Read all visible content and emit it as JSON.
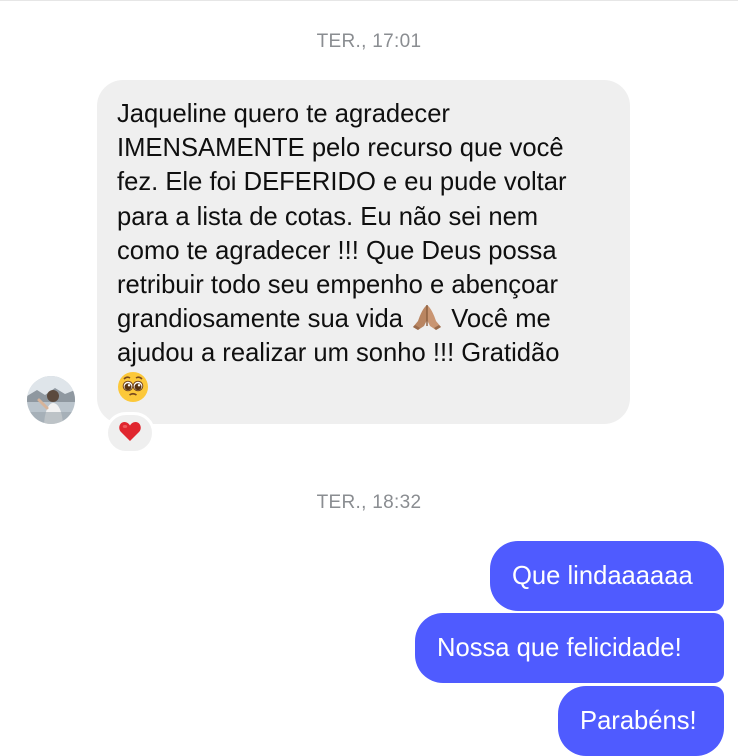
{
  "conversation": {
    "timestamps": [
      "TER., 17:01",
      "TER., 18:32"
    ],
    "incoming_message": {
      "text_before_emoji": "Jaqueline quero te agradecer\nIMENSAMENTE pelo recurso que você\nfez. Ele foi DEFERIDO e eu pude voltar\npara a lista de cotas. Eu não sei nem\ncomo te agradecer !!! Que Deus possa\nretribuir todo seu empenho e abençoar\ngrandiosamente sua vida ",
      "text_after_emoji": " Você me\najudou a realizar um sonho !!! Gratidão\n",
      "inline_emojis": [
        "folded-hands-icon",
        "pleading-face-icon"
      ],
      "reaction": "heart-icon"
    },
    "outgoing_messages": [
      "Que lindaaaaaa",
      "Nossa que felicidade!",
      "Parabéns!"
    ]
  },
  "colors": {
    "outgoing_bubble": "#4f5bff",
    "incoming_bubble": "#efefef",
    "timestamp": "#8a8d91",
    "reaction_heart": "#e0262f"
  }
}
